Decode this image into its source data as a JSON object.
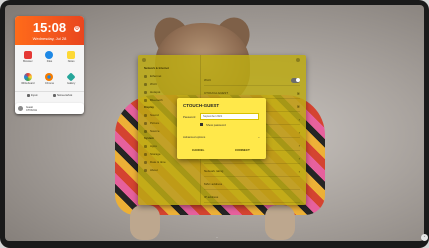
{
  "clock": {
    "time": "15:08",
    "date": "Wednesday, Jul 28"
  },
  "apps": [
    {
      "label": "Browser",
      "color": "#e53935",
      "icon": "browser-icon"
    },
    {
      "label": "Files",
      "color": "#1e88e5",
      "icon": "files-icon"
    },
    {
      "label": "Notes",
      "color": "#fdd835",
      "icon": "notes-icon"
    },
    {
      "label": "Whiteboard",
      "color": "#8e24aa",
      "icon": "whiteboard-icon"
    },
    {
      "label": "Chrome",
      "color": "#f57c00",
      "icon": "chrome-icon"
    },
    {
      "label": "Gallery",
      "color": "#26a69a",
      "icon": "gallery-icon"
    }
  ],
  "quick": {
    "left": "Input",
    "right": "Screenshot"
  },
  "user": {
    "line1": "Guest",
    "line2": "CTOUCH"
  },
  "settings": {
    "sections": {
      "top": "Network & Internet",
      "mid": "Display",
      "bottom": "System"
    },
    "sidebar": [
      "Ethernet",
      "Wi-Fi",
      "Hotspot",
      "Bluetooth",
      "Sound",
      "Picture",
      "Source",
      "Apps",
      "Storage",
      "Date & time",
      "About"
    ],
    "rows": [
      "Wi-Fi",
      "CTOUCH-GUEST",
      "CTOUCH-OFFICE",
      "Add network",
      "Saved networks",
      "Wi-Fi preferences",
      "Advanced",
      "Network rating",
      "MAC address",
      "IP address"
    ]
  },
  "dialog": {
    "title": "CTOUCH-GUEST",
    "password_label": "Password",
    "password_value": "September 2021",
    "show_password": "Show password",
    "advanced_options": "Advanced options",
    "cancel": "CANCEL",
    "connect": "CONNECT"
  },
  "bottom": {
    "hint": "^"
  },
  "colors": {
    "accent": "#ffe84a",
    "panel": "#bbaa14",
    "clock": "#ff6b1a"
  }
}
